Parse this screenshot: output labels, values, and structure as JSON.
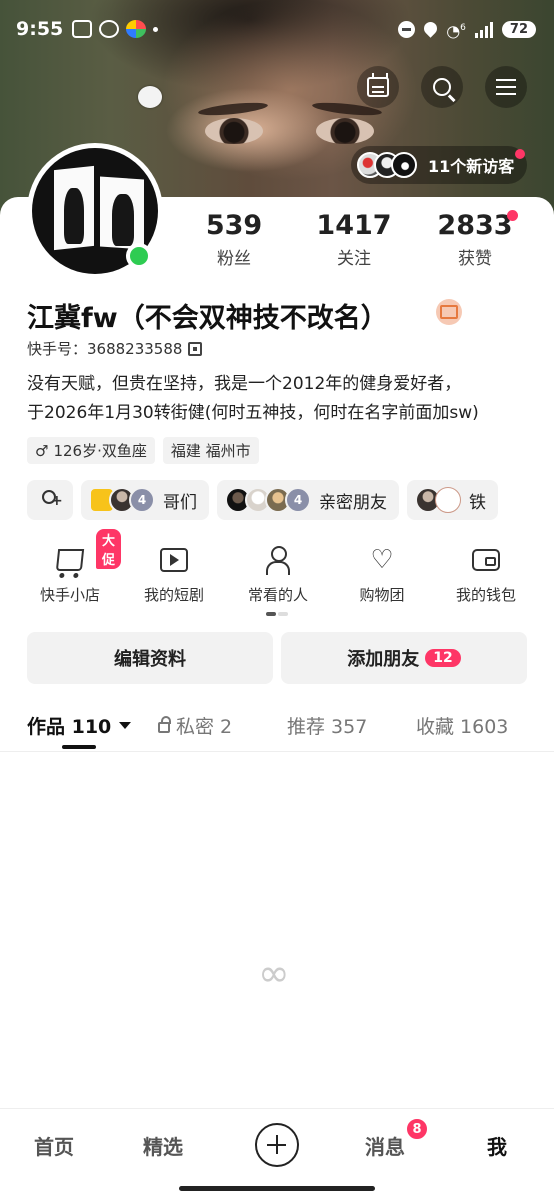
{
  "status_bar": {
    "time": "9:55",
    "network": "6",
    "battery": "72"
  },
  "visitors": {
    "text": "11个新访客"
  },
  "stats": [
    {
      "num": "539",
      "label": "粉丝"
    },
    {
      "num": "1417",
      "label": "关注"
    },
    {
      "num": "2833",
      "label": "获赞"
    }
  ],
  "profile": {
    "name": "江冀fw（不会双神技不改名）",
    "kuaishou_id": "快手号：3688233588",
    "bio_line1": "没有天赋，但贵在坚持，我是一个2012年的健身爱好者，",
    "bio_line2": "于2026年1月30转街健(何时五神技，何时在名字前面加sw)",
    "tag_age": "126岁·双鱼座",
    "tag_location": "福建 福州市"
  },
  "groups": [
    {
      "name": "哥们",
      "count": "4"
    },
    {
      "name": "亲密朋友",
      "count": "4"
    },
    {
      "name": "铁"
    }
  ],
  "shortcuts": [
    {
      "label": "快手小店",
      "promo": "大促"
    },
    {
      "label": "我的短剧"
    },
    {
      "label": "常看的人"
    },
    {
      "label": "购物团"
    },
    {
      "label": "我的钱包"
    }
  ],
  "buttons": {
    "edit": "编辑资料",
    "add_friend": "添加朋友",
    "add_friend_count": "12"
  },
  "tabs": [
    {
      "label": "作品 110"
    },
    {
      "label": "私密 2"
    },
    {
      "label": "推荐 357"
    },
    {
      "label": "收藏 1603"
    }
  ],
  "bottom_nav": {
    "home": "首页",
    "featured": "精选",
    "messages": "消息",
    "messages_badge": "8",
    "me": "我"
  },
  "colors": {
    "accent": "#fe3666",
    "online": "#2ecc52"
  }
}
